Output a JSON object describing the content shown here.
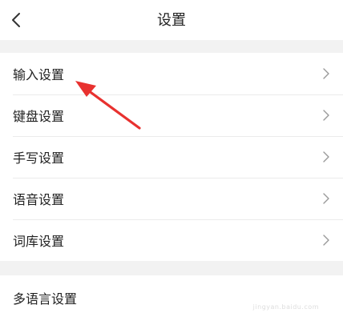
{
  "header": {
    "title": "设置",
    "back_icon": "chevron-left-icon"
  },
  "settings_group_1": {
    "items": [
      {
        "label": "输入设置",
        "icon": "chevron-right-icon"
      },
      {
        "label": "键盘设置",
        "icon": "chevron-right-icon"
      },
      {
        "label": "手写设置",
        "icon": "chevron-right-icon"
      },
      {
        "label": "语音设置",
        "icon": "chevron-right-icon"
      },
      {
        "label": "词库设置",
        "icon": "chevron-right-icon"
      }
    ]
  },
  "settings_group_2": {
    "items": [
      {
        "label": "多语言设置"
      }
    ]
  },
  "annotation": {
    "arrow_color": "#e8312f"
  },
  "watermark": {
    "text": "jingyan.baidu.com"
  },
  "colors": {
    "background": "#f2f2f2",
    "surface": "#ffffff",
    "divider": "#ebebeb",
    "text": "#222222",
    "chevron": "#999999"
  }
}
